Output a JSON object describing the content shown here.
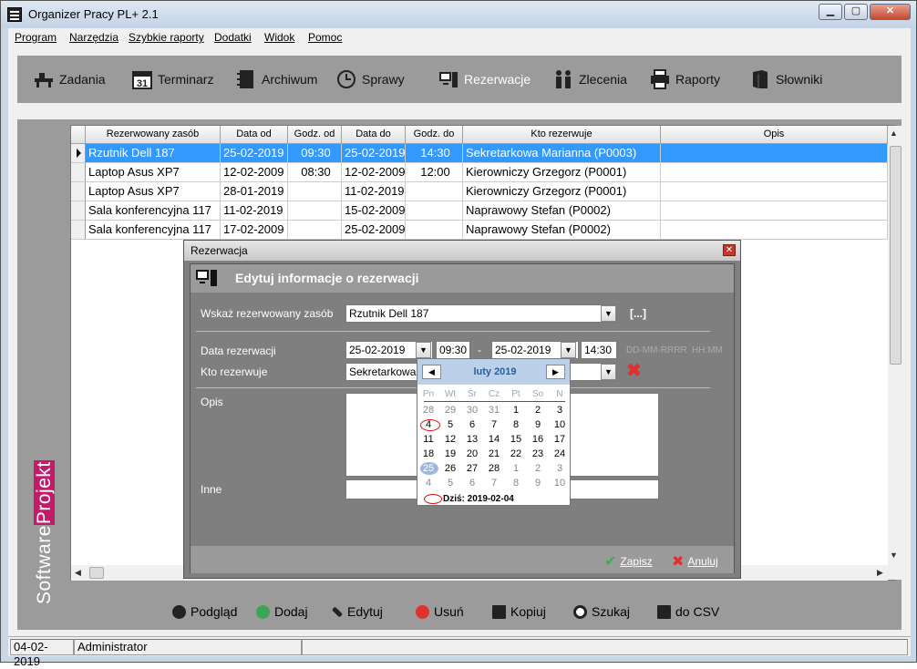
{
  "window": {
    "title": "Organizer Pracy PL+ 2.1"
  },
  "menu": [
    "Program",
    "Narzędzia",
    "Szybkie raporty",
    "Dodatki",
    "Widok",
    "Pomoc"
  ],
  "toolbar": {
    "zadania": "Zadania",
    "terminarz": "Terminarz",
    "terminarz_icon_num": "31",
    "archiwum": "Archiwum",
    "sprawy": "Sprawy",
    "rezerwacje": "Rezerwacje",
    "zlecenia": "Zlecenia",
    "raporty": "Raporty",
    "slowniki": "Słowniki"
  },
  "brand": {
    "part1": "Software",
    "part2": "Projekt"
  },
  "grid": {
    "columns": [
      "Rezerwowany zasób",
      "Data od",
      "Godz. od",
      "Data do",
      "Godz. do",
      "Kto rezerwuje",
      "Opis"
    ],
    "rows": [
      [
        "Rzutnik Dell 187",
        "25-02-2019",
        "09:30",
        "25-02-2019",
        "14:30",
        "Sekretarkowa Marianna (P0003)",
        ""
      ],
      [
        "Laptop Asus XP7",
        "12-02-2009",
        "08:30",
        "12-02-2009",
        "12:00",
        "Kierowniczy Grzegorz (P0001)",
        ""
      ],
      [
        "Laptop Asus XP7",
        "28-01-2019",
        "",
        "11-02-2019",
        "",
        "Kierowniczy Grzegorz (P0001)",
        ""
      ],
      [
        "Sala konferencyjna 117",
        "11-02-2019",
        "",
        "15-02-2009",
        "",
        "Naprawowy Stefan (P0002)",
        ""
      ],
      [
        "Sala konferencyjna 117",
        "17-02-2009",
        "",
        "25-02-2009",
        "",
        "Naprawowy Stefan (P0002)",
        ""
      ]
    ],
    "selected_row": 0
  },
  "actions": {
    "podglad": "Podgląd",
    "dodaj": "Dodaj",
    "edytuj": "Edytuj",
    "usun": "Usuń",
    "kopiuj": "Kopiuj",
    "szukaj": "Szukaj",
    "csv": "do CSV"
  },
  "status": {
    "date": "04-02-2019",
    "user": "Administrator"
  },
  "dialog": {
    "title": "Rezerwacja",
    "close_glyph": "✕",
    "heading": "Edytuj informacje o  rezerwacji",
    "resource_label": "Wskaż rezerwowany zasób",
    "resource_value": "Rzutnik Dell 187",
    "browse_label": "[...]",
    "date_label": "Data rezerwacji",
    "date_from": "25-02-2019",
    "time_from": "09:30",
    "range_sep": "-",
    "date_to": "25-02-2019",
    "time_to": "14:30",
    "date_hint": "DD-MM-RRRR",
    "time_hint": "HH:MM",
    "who_label": "Kto rezerwuje",
    "who_value": "Sekretarkowa M",
    "opis_label": "Opis",
    "inne_label": "Inne",
    "save_label": "Zapisz",
    "cancel_label": "Anuluj"
  },
  "calendar": {
    "month": "luty 2019",
    "weekdays": [
      "Pn",
      "Wt",
      "Śr",
      "Cz",
      "Pt",
      "So",
      "N"
    ],
    "weeks": [
      [
        "28",
        "29",
        "30",
        "31",
        "1",
        "2",
        "3"
      ],
      [
        "4",
        "5",
        "6",
        "7",
        "8",
        "9",
        "10"
      ],
      [
        "11",
        "12",
        "13",
        "14",
        "15",
        "16",
        "17"
      ],
      [
        "18",
        "19",
        "20",
        "21",
        "22",
        "23",
        "24"
      ],
      [
        "25",
        "26",
        "27",
        "28",
        "1",
        "2",
        "3"
      ],
      [
        "4",
        "5",
        "6",
        "7",
        "8",
        "9",
        "10"
      ]
    ],
    "today_text": "Dziś: 2019-02-04",
    "selected_day": "25"
  }
}
